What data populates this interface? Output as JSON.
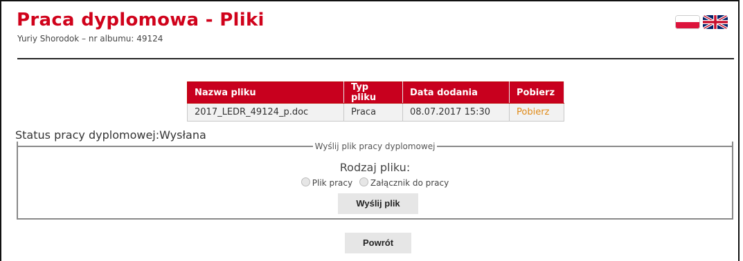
{
  "header": {
    "title": "Praca dyplomowa - Pliki",
    "subtitle": "Yuriy Shorodok – nr albumu: 49124"
  },
  "languages": [
    {
      "name": "polish-flag-icon"
    },
    {
      "name": "english-flag-icon"
    }
  ],
  "files_table": {
    "headers": [
      "Nazwa pliku",
      "Typ pliku",
      "Data dodania",
      "Pobierz"
    ],
    "rows": [
      [
        "2017_LEDR_49124_p.doc",
        "Praca",
        "08.07.2017 15:30",
        "Pobierz"
      ]
    ]
  },
  "status": {
    "text": "Status pracy dyplomowej:Wysłana"
  },
  "upload": {
    "legend": "Wyślij plik pracy dyplomowej",
    "file_type_label": "Rodzaj pliku:",
    "options": [
      "Plik pracy",
      "Załącznik do pracy"
    ],
    "submit_label": "Wyślij plik"
  },
  "back_label": "Powrót",
  "colors": {
    "accent": "#c8001e",
    "link": "#e08a17"
  }
}
